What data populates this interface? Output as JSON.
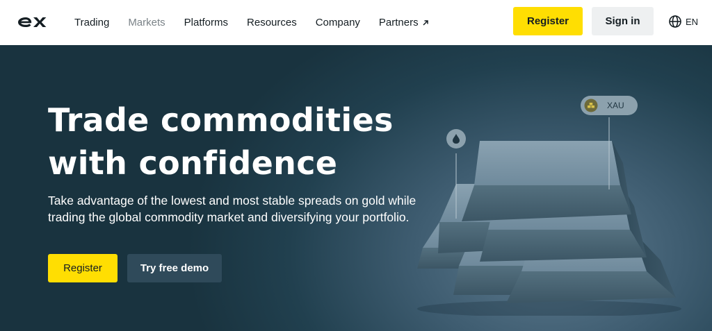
{
  "header": {
    "logo": "ex",
    "nav": [
      {
        "label": "Trading"
      },
      {
        "label": "Markets"
      },
      {
        "label": "Platforms"
      },
      {
        "label": "Resources"
      },
      {
        "label": "Company"
      },
      {
        "label": "Partners"
      }
    ],
    "register_label": "Register",
    "signin_label": "Sign in",
    "language": "EN"
  },
  "hero": {
    "title_lines": [
      "Trade commodities",
      "with confidence"
    ],
    "subtitle_lines": [
      "Take advantage of the lowest and most stable spreads on gold while",
      "trading the global commodity market and diversifying your portfolio."
    ],
    "register_label": "Register",
    "demo_label": "Try free demo",
    "badge_label": "XAU"
  },
  "colors": {
    "accent_yellow": "#ffde02",
    "hero_dark": "#19333f",
    "signin_bg": "#eef0f1",
    "demo_bg": "#2f4a5a"
  },
  "icons": {
    "logo": "exness-logo-icon",
    "partners_arrow": "arrow-up-right-icon",
    "language": "globe-icon",
    "xau": "gold-coin-icon",
    "oil": "oil-drop-icon"
  }
}
